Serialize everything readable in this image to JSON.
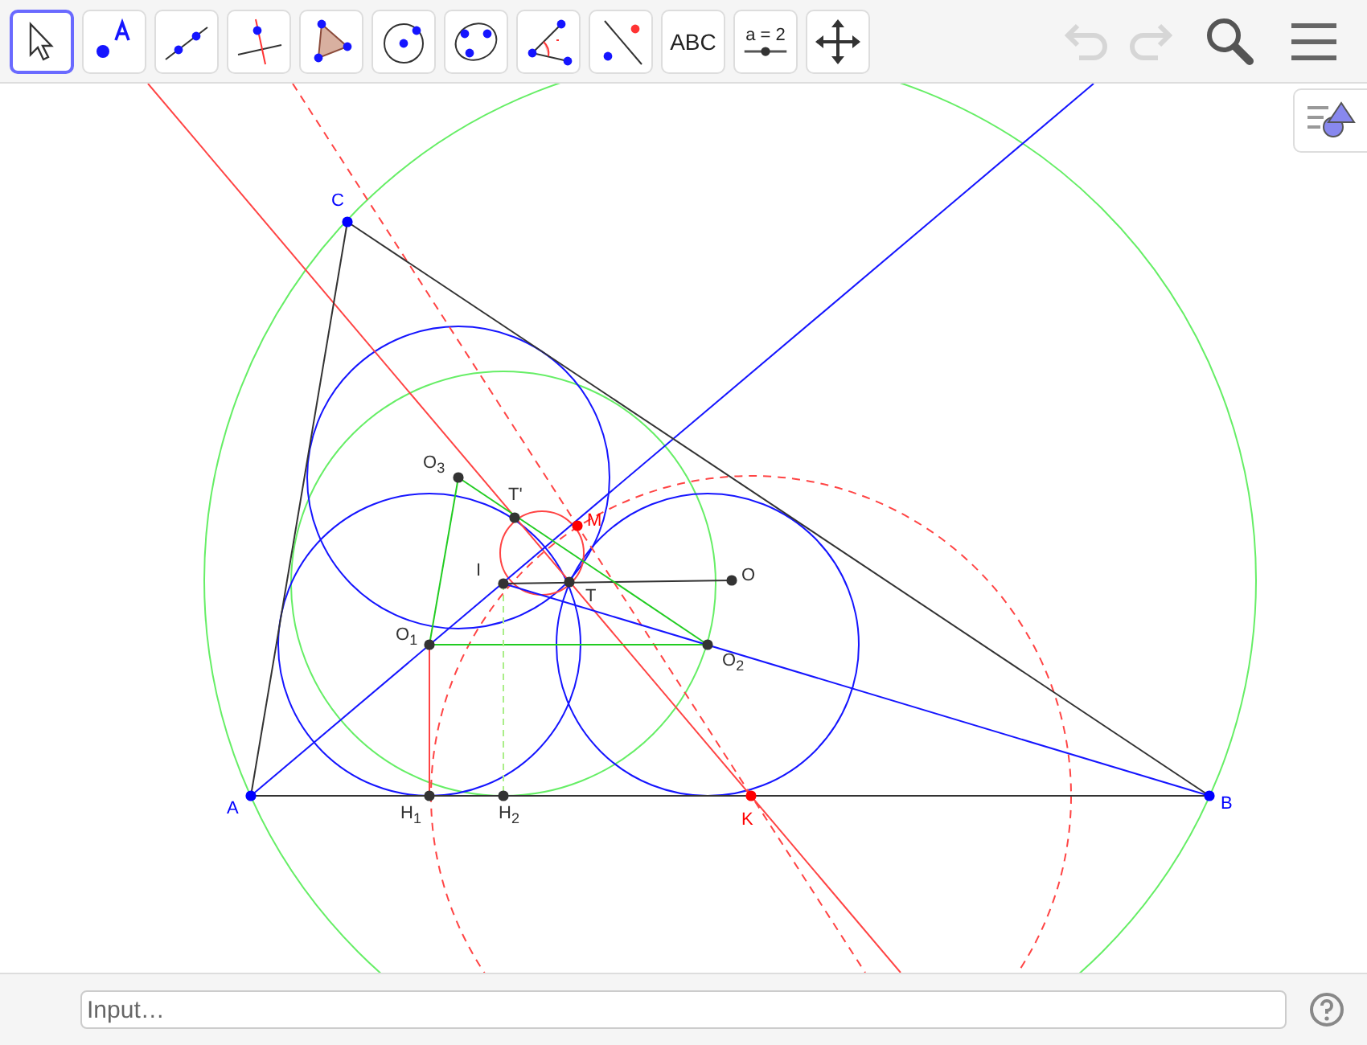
{
  "toolbar": {
    "tools": [
      {
        "kind": "move",
        "selected": true
      },
      {
        "kind": "point",
        "selected": false
      },
      {
        "kind": "line",
        "selected": false
      },
      {
        "kind": "perpendicular",
        "selected": false
      },
      {
        "kind": "polygon",
        "selected": false
      },
      {
        "kind": "circle",
        "selected": false
      },
      {
        "kind": "conic",
        "selected": false
      },
      {
        "kind": "angle",
        "selected": false
      },
      {
        "kind": "reflect",
        "selected": false
      },
      {
        "kind": "text",
        "label": "ABC",
        "selected": false
      },
      {
        "kind": "slider",
        "label": "a = 2",
        "selected": false
      },
      {
        "kind": "pan",
        "selected": false
      }
    ],
    "undo": {
      "disabled": true
    },
    "redo": {
      "disabled": true
    }
  },
  "canvas": {
    "points": [
      {
        "label": "A",
        "color": "#0000ff"
      },
      {
        "label": "B",
        "color": "#0000ff"
      },
      {
        "label": "C",
        "color": "#0000ff"
      },
      {
        "label": "O$_{3}$",
        "color": "#333333"
      },
      {
        "label": "T'",
        "color": "#333333"
      },
      {
        "label": "M",
        "color": "#ff0000"
      },
      {
        "label": "I",
        "color": "#333333"
      },
      {
        "label": "T",
        "color": "#333333"
      },
      {
        "label": "O",
        "color": "#333333"
      },
      {
        "label": "O$_{1}$",
        "color": "#333333"
      },
      {
        "label": "O$_{2}$",
        "color": "#333333"
      },
      {
        "label": "H$_{1}$",
        "color": "#333333"
      },
      {
        "label": "H$_{2}$",
        "color": "#333333"
      },
      {
        "label": "K",
        "color": "#ff0000"
      }
    ]
  },
  "input_bar": {
    "placeholder": "Input…"
  }
}
